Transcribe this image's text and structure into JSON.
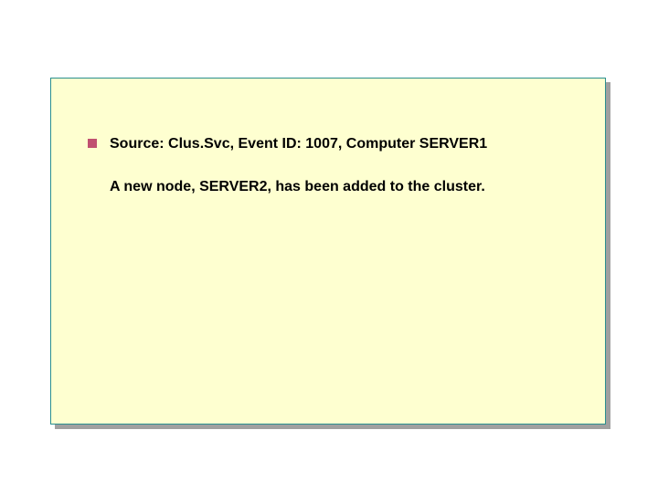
{
  "slide": {
    "bullet_heading": "Source: Clus.Svc, Event ID: 1007, Computer SERVER1",
    "body": "A new node, SERVER2, has been added to the cluster."
  }
}
